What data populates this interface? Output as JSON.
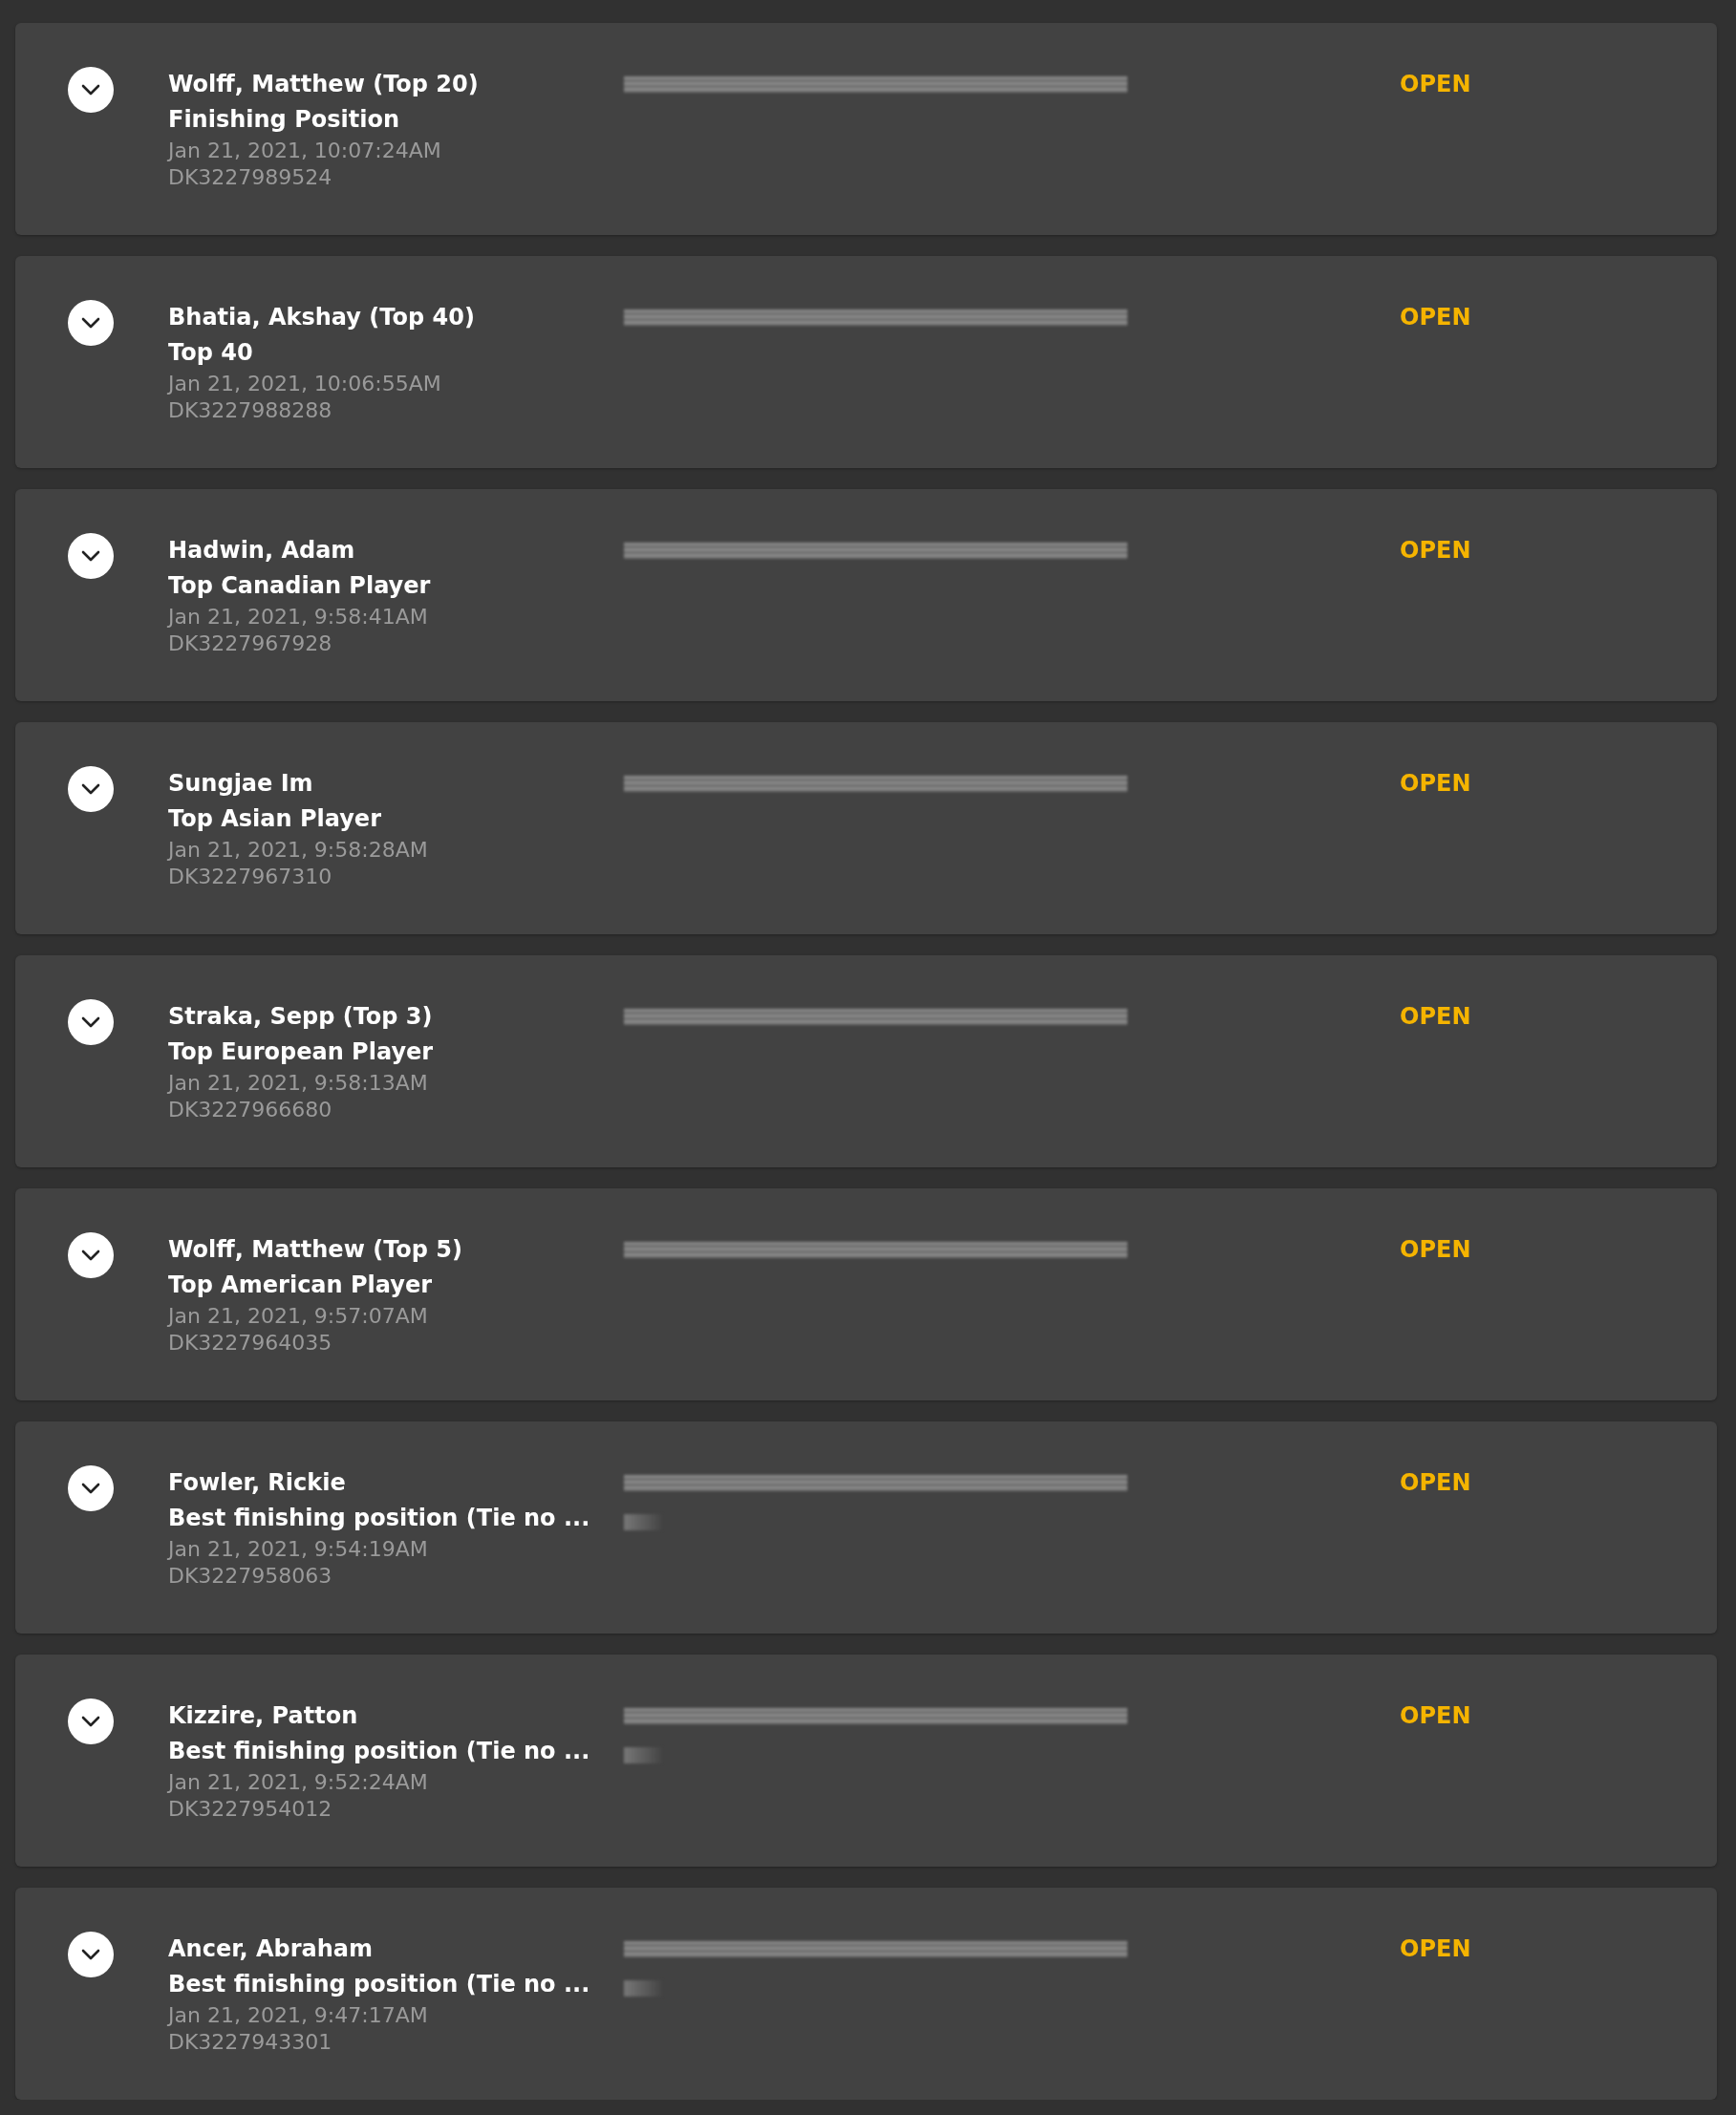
{
  "bets": [
    {
      "selection": "Wolff, Matthew (Top 20)",
      "market": "Finishing Position",
      "placed": "Jan 21, 2021, 10:07:24AM",
      "ticket": "DK3227989524",
      "status": "OPEN",
      "expanded": false,
      "kind": "single"
    },
    {
      "selection": "Bhatia, Akshay (Top 40)",
      "market": "Top 40",
      "placed": "Jan 21, 2021, 10:06:55AM",
      "ticket": "DK3227988288",
      "status": "OPEN",
      "expanded": false,
      "kind": "single"
    },
    {
      "selection": "Hadwin, Adam",
      "market": "Top Canadian Player",
      "placed": "Jan 21, 2021, 9:58:41AM",
      "ticket": "DK3227967928",
      "status": "OPEN",
      "expanded": false,
      "kind": "single"
    },
    {
      "selection": "Sungjae Im",
      "market": "Top Asian Player",
      "placed": "Jan 21, 2021, 9:58:28AM",
      "ticket": "DK3227967310",
      "status": "OPEN",
      "expanded": false,
      "kind": "single"
    },
    {
      "selection": "Straka, Sepp (Top 3)",
      "market": "Top European Player",
      "placed": "Jan 21, 2021, 9:58:13AM",
      "ticket": "DK3227966680",
      "status": "OPEN",
      "expanded": false,
      "kind": "single"
    },
    {
      "selection": "Wolff, Matthew (Top 5)",
      "market": "Top American Player",
      "placed": "Jan 21, 2021, 9:57:07AM",
      "ticket": "DK3227964035",
      "status": "OPEN",
      "expanded": false,
      "kind": "single"
    },
    {
      "selection": "Fowler, Rickie",
      "market": "Best finishing position (Tie no ...",
      "placed": "Jan 21, 2021, 9:54:19AM",
      "ticket": "DK3227958063",
      "status": "OPEN",
      "expanded": false,
      "kind": "double"
    },
    {
      "selection": "Kizzire, Patton",
      "market": "Best finishing position (Tie no ...",
      "placed": "Jan 21, 2021, 9:52:24AM",
      "ticket": "DK3227954012",
      "status": "OPEN",
      "expanded": false,
      "kind": "double"
    },
    {
      "selection": "Ancer, Abraham",
      "market": "Best finishing position (Tie no ...",
      "placed": "Jan 21, 2021, 9:47:17AM",
      "ticket": "DK3227943301",
      "status": "OPEN",
      "expanded": false,
      "kind": "double"
    }
  ]
}
